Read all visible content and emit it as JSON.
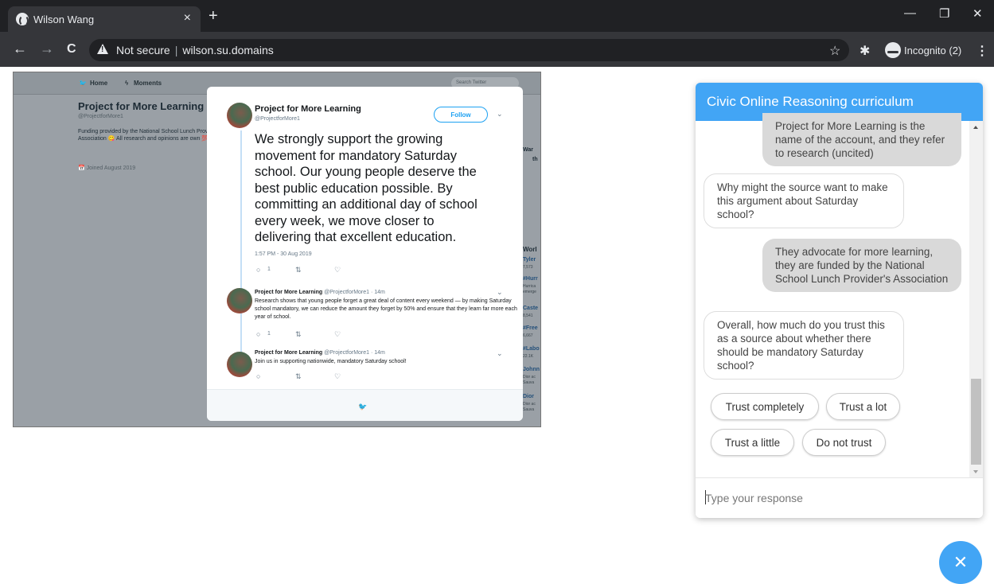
{
  "browser": {
    "tab_title": "Wilson Wang",
    "tab_close": "×",
    "new_tab": "+",
    "minimize": "—",
    "restore": "❐",
    "close": "✕",
    "back": "←",
    "forward": "→",
    "reload": "C",
    "security_label": "Not secure",
    "url": "wilson.su.domains",
    "star": "☆",
    "extensions": "✱",
    "incognito_label": "Incognito (2)",
    "menu": "⋮"
  },
  "screenshot": {
    "nav_home": "Home",
    "nav_moments": "Moments",
    "search_placeholder": "Search Twitter",
    "profile": {
      "name": "Project for More Learning",
      "handle": "@ProjectforMore1",
      "bio": "Funding provided by the National School Lunch Provider's Association 😋 All research and opinions are own 💯",
      "joined": "Joined August 2019"
    },
    "main_tweet": {
      "name": "Project for More Learning",
      "handle": "@ProjectforMore1",
      "follow_label": "Follow",
      "text": "We strongly support the growing movement for mandatory Saturday school. Our young people deserve the best public education possible. By committing an additional day of school every week, we move closer to delivering that excellent education.",
      "timestamp": "1:57 PM - 30 Aug 2019",
      "reply_count": "1"
    },
    "reply1": {
      "name": "Project for More Learning",
      "meta": "@ProjectforMore1 · 14m",
      "text": "Research shows that young people forget a great deal of content every weekend — by making Saturday school mandatory, we can reduce the amount they forget by 50% and ensure that they learn far more each year of school.",
      "reply_count": "1"
    },
    "reply2": {
      "name": "Project for More Learning",
      "meta": "@ProjectforMore1 · 14m",
      "text": "Join us in supporting nationwide, mandatory Saturday school!"
    },
    "side_fragments": [
      "War",
      "th",
      "Worl",
      "Tyler",
      "7,573",
      "#Hurr",
      "Hurrica",
      "emerge",
      "Caste",
      "8,541",
      "#Free",
      "6,667",
      "#Labo",
      "22.1K",
      "Johnn",
      "Dior ac",
      "Sauva",
      "Dior",
      "Dior ac",
      "Sauva"
    ]
  },
  "chat": {
    "title": "Civic Online Reasoning curriculum",
    "messages": [
      {
        "from": "user",
        "text": "Project for More Learning is the name of the account, and they refer to research (uncited)"
      },
      {
        "from": "bot",
        "text": "Why might the source want to make this argument about Saturday school?"
      },
      {
        "from": "user",
        "text": "They advocate for more learning, they are funded by the National School Lunch Provider's Association"
      },
      {
        "from": "bot",
        "text": "Overall, how much do you trust this as a source about whether there should be mandatory Saturday school?"
      }
    ],
    "quick_replies": [
      "Trust completely",
      "Trust a lot",
      "Trust a little",
      "Do not trust"
    ],
    "input_placeholder": "Type your response",
    "close_label": "✕"
  },
  "colors": {
    "chat_accent": "#42a5f5",
    "twitter_blue": "#1da1f2",
    "chrome_dark": "#202124"
  }
}
